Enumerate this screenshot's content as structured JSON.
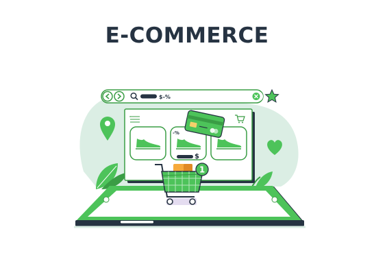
{
  "title": "E-COMMERCE",
  "search": {
    "query_suffix": "$-%"
  },
  "badges": {
    "discount": "-%",
    "price": "$",
    "cart_count": "1"
  },
  "colors": {
    "dark": "#263342",
    "green": "#4dc35a",
    "green_dark": "#3a9d45",
    "green_light": "#bfe8c0",
    "bg_blob": "#dbeee4",
    "accent_orange": "#f6a93b"
  },
  "icons": [
    "back-arrow-icon",
    "forward-arrow-icon",
    "search-icon",
    "clear-icon",
    "star-icon",
    "location-pin-icon",
    "heart-icon",
    "menu-icon",
    "cart-icon",
    "credit-card-icon",
    "sneaker-icon",
    "shopping-cart-icon",
    "leaf-icon"
  ]
}
